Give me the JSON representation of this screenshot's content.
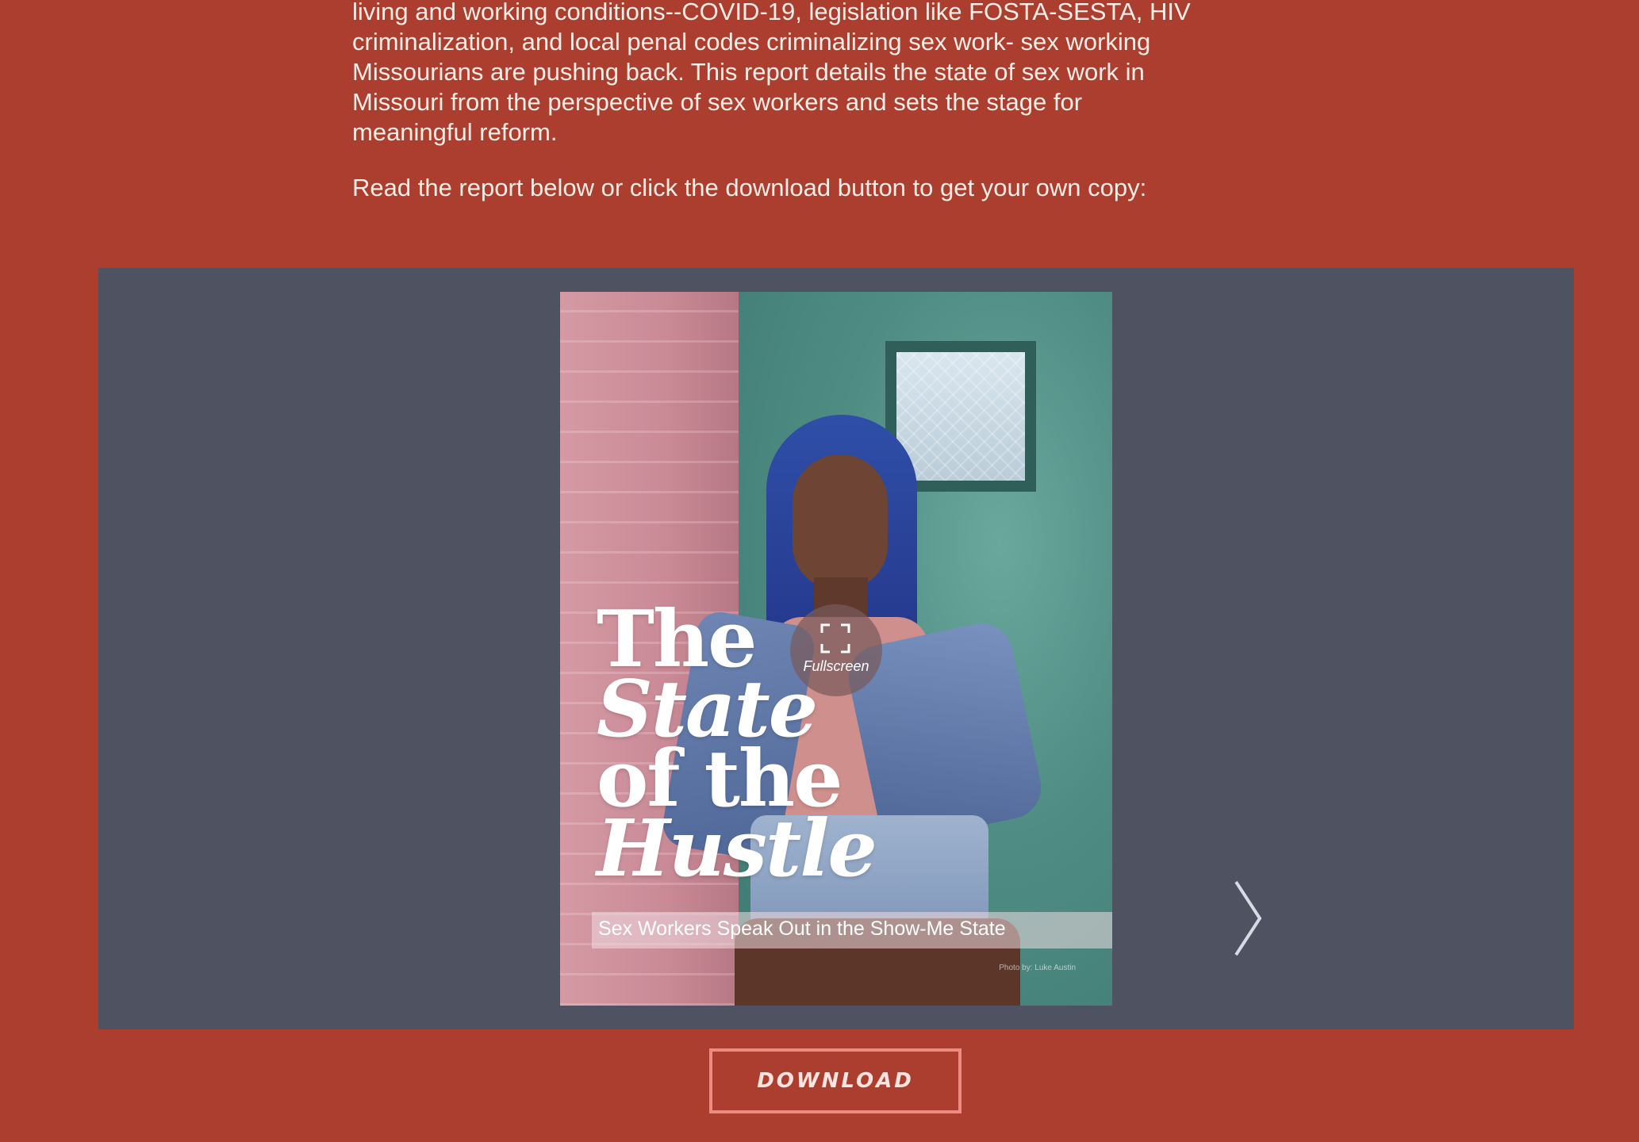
{
  "intro": {
    "lines": [
      "living and working conditions--COVID-19, legislation like FOSTA-SESTA, HIV",
      "criminalization, and local penal codes criminalizing sex work- sex working",
      "Missourians are pushing back. This report details the state of sex work in",
      "Missouri from the perspective of sex workers and sets the stage for",
      "meaningful reform."
    ],
    "cta": "Read the report below or click the download button to get your own copy:"
  },
  "viewer": {
    "cover": {
      "title_line1": "The",
      "title_line2": "State",
      "title_line3": "of the",
      "title_line4": "Hustle",
      "subtitle": "Sex Workers Speak Out in the Show-Me State",
      "photo_credit": "Photo by: Luke Austin"
    },
    "fullscreen_label": "Fullscreen",
    "next_icon": "chevron-right-icon",
    "fullscreen_icon": "expand-icon"
  },
  "download": {
    "label": "DOWNLOAD"
  },
  "colors": {
    "page_background": "#ab3e2e",
    "viewer_background": "#4f5260",
    "download_border": "#ec8c82",
    "text_light": "#f7ede6"
  }
}
